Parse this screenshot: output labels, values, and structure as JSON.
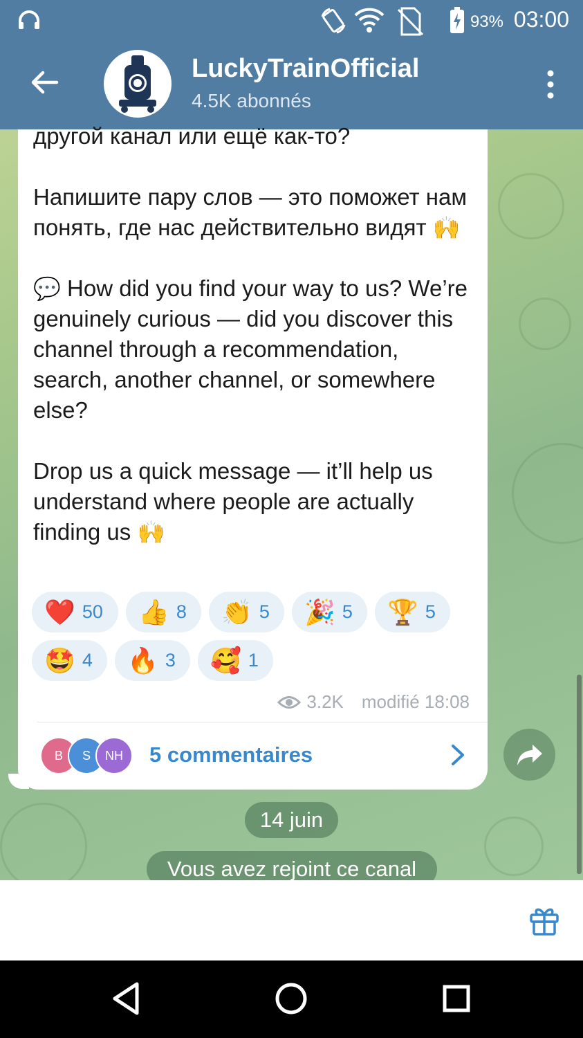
{
  "status_bar": {
    "time": "03:00",
    "battery": "93%",
    "icons": [
      "headphones-icon",
      "rotate-icon",
      "wifi-icon",
      "no-sim-icon",
      "battery-charging-icon"
    ]
  },
  "header": {
    "title": "LuckyTrainOfficial",
    "subtitle": "4.5K abonnés",
    "back_icon": "arrow-left-icon",
    "more_icon": "more-vertical-icon"
  },
  "message": {
    "text_ru_end": "другой канал или ещё как-то?",
    "text_ru_p2": "Напишите пару слов — это поможет нам понять, где нас действительно видят",
    "text_ru_p2_emoji": "🙌",
    "text_en_p1_emoji": "💬",
    "text_en_p1": "How did you find your way to us? We’re genuinely curious — did you discover this channel through a recommendation, search, another channel, or somewhere else?",
    "text_en_p2": "Drop us a quick message — it’ll help us understand where people are actually finding us",
    "text_en_p2_emoji": "🙌",
    "reactions": [
      {
        "emoji": "❤️",
        "count": "50"
      },
      {
        "emoji": "👍",
        "count": "8"
      },
      {
        "emoji": "👏",
        "count": "5"
      },
      {
        "emoji": "🎉",
        "count": "5"
      },
      {
        "emoji": "🏆",
        "count": "5"
      },
      {
        "emoji": "🤩",
        "count": "4"
      },
      {
        "emoji": "🔥",
        "count": "3"
      },
      {
        "emoji": "🥰",
        "count": "1"
      }
    ],
    "views": "3.2K",
    "edited": "modifié 18:08",
    "comments": {
      "avatars": [
        {
          "initials": "B",
          "color": "#e06a8c"
        },
        {
          "initials": "S",
          "color": "#4a8fd8"
        },
        {
          "initials": "NH",
          "color": "#9c6ad4"
        }
      ],
      "label": "5 commentaires"
    }
  },
  "date_pill": "14 juin",
  "service_message": "Vous avez rejoint ce canal",
  "bottom": {
    "gift_icon": "gift-icon"
  },
  "navigation": [
    "back-triangle-icon",
    "home-circle-icon",
    "recents-square-icon"
  ]
}
